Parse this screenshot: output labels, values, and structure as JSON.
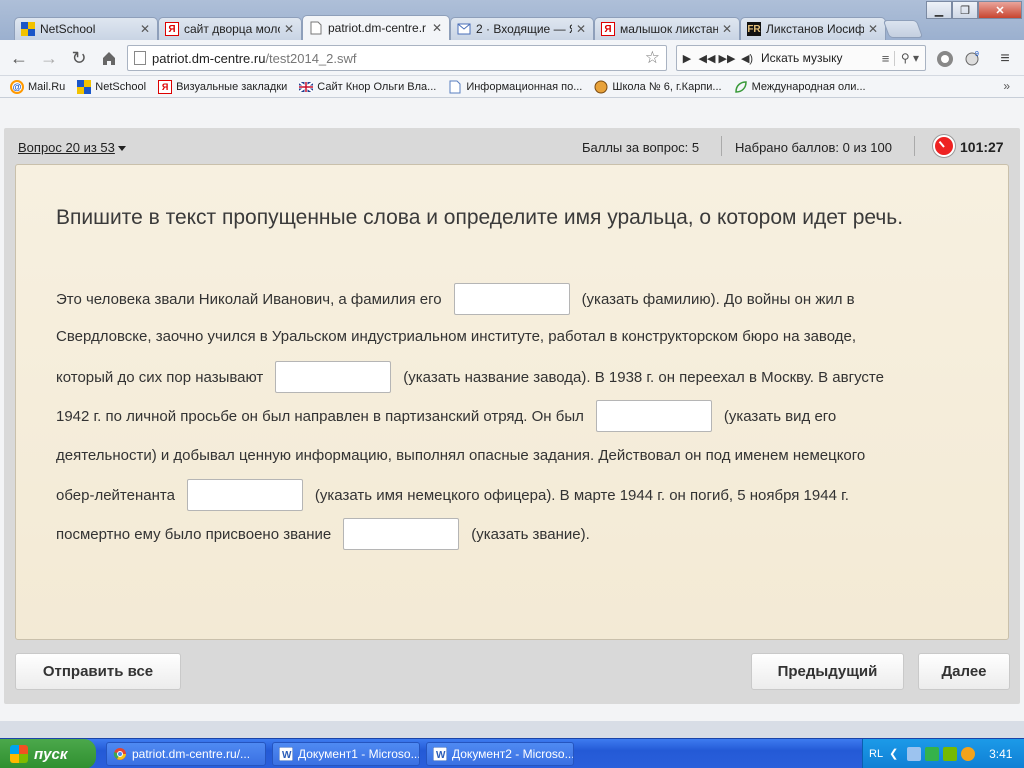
{
  "browser": {
    "tabs": [
      {
        "title": "NetSchool",
        "icon": "netschool-icon",
        "active": false
      },
      {
        "title": "сайт дворца моло",
        "icon": "yandex-icon",
        "active": false
      },
      {
        "title": "patriot.dm-centre.r",
        "icon": "page-icon",
        "active": true
      },
      {
        "title": "2 · Входящие — Я",
        "icon": "mail-icon",
        "active": false
      },
      {
        "title": "малышок ликстан",
        "icon": "yandex-icon",
        "active": false
      },
      {
        "title": "Ликстанов Иосиф",
        "icon": "fr-icon",
        "active": false
      }
    ],
    "url_host": "patriot.dm-centre.ru",
    "url_path": "/test2014_2.swf",
    "music_search_label": "Искать музыку",
    "bookmarks": [
      {
        "label": "Mail.Ru",
        "icon": "mailru-icon"
      },
      {
        "label": "NetSchool",
        "icon": "netschool-icon"
      },
      {
        "label": "Визуальные закладки",
        "icon": "yandex-icon"
      },
      {
        "label": "Сайт Кнор Ольги Вла...",
        "icon": "uk-flag-icon"
      },
      {
        "label": "Информационная по...",
        "icon": "doc-icon"
      },
      {
        "label": "Школа № 6, г.Карпи...",
        "icon": "globe-icon"
      },
      {
        "label": "Международная оли...",
        "icon": "leaf-icon"
      }
    ],
    "bookmarks_more": "»"
  },
  "quiz": {
    "question_selector": "Вопрос 20 из 53",
    "points_for_question": "Баллы за вопрос: 5",
    "points_total": "Набрано баллов: 0 из 100",
    "timer": "101:27",
    "title": "Впишите в текст пропущенные слова и  определите имя уральца, о котором идет речь.",
    "lines": [
      {
        "before": "Это человека звали Николай Иванович, а фамилия его",
        "after": "(указать фамилию).  До войны он жил в"
      },
      {
        "before": "Свердловске, заочно учился в Уральском индустриальном институте, работал в конструкторском бюро на заводе,",
        "after": ""
      },
      {
        "before": "который до сих пор называют",
        "after": "(указать название завода).  В 1938 г. он переехал в Москву. В августе"
      },
      {
        "before": "1942 г. по личной просьбе он был направлен в партизанский отряд. Он был",
        "after": "(указать вид его"
      },
      {
        "before": "деятельности) и добывал ценную информацию, выполнял опасные задания. Действовал он под именем немецкого",
        "after": ""
      },
      {
        "before": "обер-лейтенанта",
        "after": "(указать имя немецкого офицера). В марте 1944 г. он погиб, 5 ноября 1944 г."
      },
      {
        "before": "посмертно ему было присвоено звание",
        "after": "(указать звание)."
      }
    ],
    "send_all_label": "Отправить все",
    "previous_label": "Предыдущий",
    "next_label": "Далее"
  },
  "taskbar": {
    "start_label": "пуск",
    "tasks": [
      {
        "label": "patriot.dm-centre.ru/...",
        "icon": "chrome-icon"
      },
      {
        "label": "Документ1 - Microso...",
        "icon": "word-icon"
      },
      {
        "label": "Документ2 - Microso...",
        "icon": "word-icon"
      }
    ],
    "language": "RL",
    "clock": "3:41"
  },
  "colors": {
    "question_bg": "#f5edda",
    "panel_bg": "#d9d9d9",
    "taskbar_blue": "#245ad6",
    "start_green": "#3c9a3c",
    "timer_red": "#e22222"
  }
}
